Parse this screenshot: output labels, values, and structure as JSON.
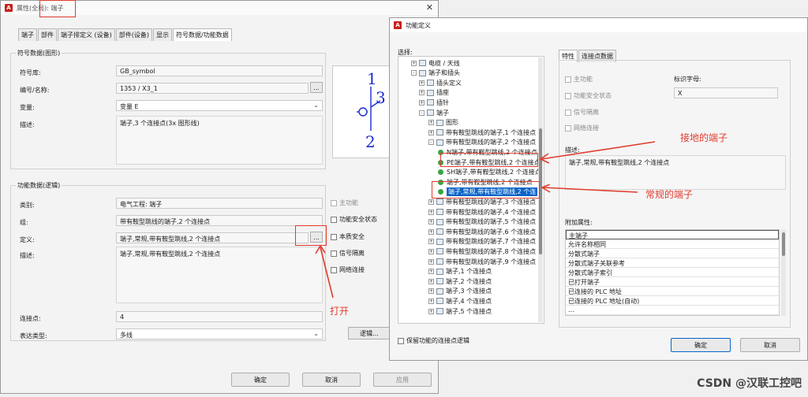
{
  "main_window": {
    "title": "属性(全局): 端子",
    "tabs": [
      "端子",
      "部件",
      "端子排定义 (设备)",
      "部件(设备)",
      "显示",
      "符号数据/功能数据"
    ],
    "symbol_group": {
      "title": "符号数据(图形)",
      "lib_label": "符号库:",
      "lib_value": "GB_symbol",
      "number_label": "编号/名称:",
      "number_value": "1353 / X3_1",
      "variant_label": "变量:",
      "variant_value": "变量 E",
      "desc_label": "描述:",
      "desc_value": "端子,3 个连接点(3x 图形线)"
    },
    "symbol_preview": {
      "label_top": "1",
      "label_right": "3",
      "label_bottom": "2"
    },
    "func_group": {
      "title": "功能数据(逻辑)",
      "category_label": "类别:",
      "category_value": "电气工程: 端子",
      "group_label": "组:",
      "group_value": "带有鞍型跳线的端子,2 个连接点",
      "def_label": "定义:",
      "def_value": "端子,常规,带有鞍型跳线,2 个连接点",
      "desc_label": "描述:",
      "desc_value": "端子,常规,带有鞍型跳线,2 个连接点",
      "conn_label": "连接点:",
      "conn_value": "4",
      "repr_label": "表达类型:",
      "repr_value": "多线",
      "logic_button": "逻辑..."
    },
    "checkboxes": [
      "主功能",
      "功能安全状态",
      "本质安全",
      "信号隔离",
      "网络连接"
    ],
    "ellipsis": "...",
    "buttons": {
      "ok": "确定",
      "cancel": "取消",
      "apply": "应用"
    }
  },
  "func_dialog": {
    "title": "功能定义",
    "select_label": "选择:",
    "tree": [
      {
        "text": "电缆 / 天线",
        "kind": "folder",
        "level": 1,
        "pm": "+"
      },
      {
        "text": "端子和插头",
        "kind": "folder",
        "level": 1,
        "pm": "-"
      },
      {
        "text": "插头定义",
        "kind": "folder",
        "level": 2,
        "pm": "+"
      },
      {
        "text": "插座",
        "kind": "folder",
        "level": 2,
        "pm": "+"
      },
      {
        "text": "插针",
        "kind": "folder",
        "level": 2,
        "pm": "+"
      },
      {
        "text": "端子",
        "kind": "folder",
        "level": 2,
        "pm": "-"
      },
      {
        "text": "图形",
        "kind": "folder",
        "level": 3,
        "pm": "+"
      },
      {
        "text": "带有鞍型跳线的端子,1 个连接点",
        "kind": "folder",
        "level": 3,
        "pm": "+"
      },
      {
        "text": "带有鞍型跳线的端子,2 个连接点",
        "kind": "folder",
        "level": 3,
        "pm": "-"
      },
      {
        "text": "N端子,带有鞍型跳线,2 个连接点",
        "kind": "leaf",
        "level": 4
      },
      {
        "text": "PE端子,带有鞍型跳线,2 个连接点",
        "kind": "leaf",
        "level": 4
      },
      {
        "text": "SH端子,带有鞍型跳线,2 个连接点",
        "kind": "leaf",
        "level": 4
      },
      {
        "text": "端子,带有鞍型跳线,2 个连接点",
        "kind": "leaf",
        "level": 4
      },
      {
        "text": "端子,常规,带有鞍型跳线,2 个连",
        "kind": "leaf",
        "level": 4,
        "selected": true
      },
      {
        "text": "带有鞍型跳线的端子,3 个连接点",
        "kind": "folder",
        "level": 3,
        "pm": "+"
      },
      {
        "text": "带有鞍型跳线的端子,4 个连接点",
        "kind": "folder",
        "level": 3,
        "pm": "+"
      },
      {
        "text": "带有鞍型跳线的端子,5 个连接点",
        "kind": "folder",
        "level": 3,
        "pm": "+"
      },
      {
        "text": "带有鞍型跳线的端子,6 个连接点",
        "kind": "folder",
        "level": 3,
        "pm": "+"
      },
      {
        "text": "带有鞍型跳线的端子,7 个连接点",
        "kind": "folder",
        "level": 3,
        "pm": "+"
      },
      {
        "text": "带有鞍型跳线的端子,8 个连接点",
        "kind": "folder",
        "level": 3,
        "pm": "+"
      },
      {
        "text": "带有鞍型跳线的端子,9 个连接点",
        "kind": "folder",
        "level": 3,
        "pm": "+"
      },
      {
        "text": "端子,1 个连接点",
        "kind": "folder",
        "level": 3,
        "pm": "+"
      },
      {
        "text": "端子,2 个连接点",
        "kind": "folder",
        "level": 3,
        "pm": "+"
      },
      {
        "text": "端子,3 个连接点",
        "kind": "folder",
        "level": 3,
        "pm": "+"
      },
      {
        "text": "端子,4 个连接点",
        "kind": "folder",
        "level": 3,
        "pm": "+"
      },
      {
        "text": "端子,5 个连接点",
        "kind": "folder",
        "level": 3,
        "pm": "+"
      }
    ],
    "keep_checkbox": "保留功能的连接点逻辑",
    "tabs": [
      "特性",
      "连接点数据"
    ],
    "props_checkboxes": [
      "主功能",
      "功能安全状态",
      "信号隔离",
      "网络连接"
    ],
    "identifier_label": "标识字母:",
    "identifier_value": "X",
    "desc_label": "描述:",
    "desc_value": "端子,常规,带有鞍型跳线,2 个连接点",
    "extra_label": "附加属性:",
    "extra_props": [
      "主端子",
      "允许名称相同",
      "分散式端子",
      "分散式端子关联参考",
      "分散式端子索引",
      "已打开端子",
      "已连接的 PLC 地址",
      "已连接的 PLC 地址(自动)",
      "..."
    ],
    "buttons": {
      "ok": "确定",
      "cancel": "取消"
    }
  },
  "annotations": {
    "grounded": "接地的端子",
    "regular": "常规的端子",
    "open": "打开"
  },
  "watermark": "CSDN @汉联工控吧",
  "colors": {
    "accent": "#0a64c8",
    "annotation": "#e03d2e",
    "leaf_dot": "#37a447"
  }
}
